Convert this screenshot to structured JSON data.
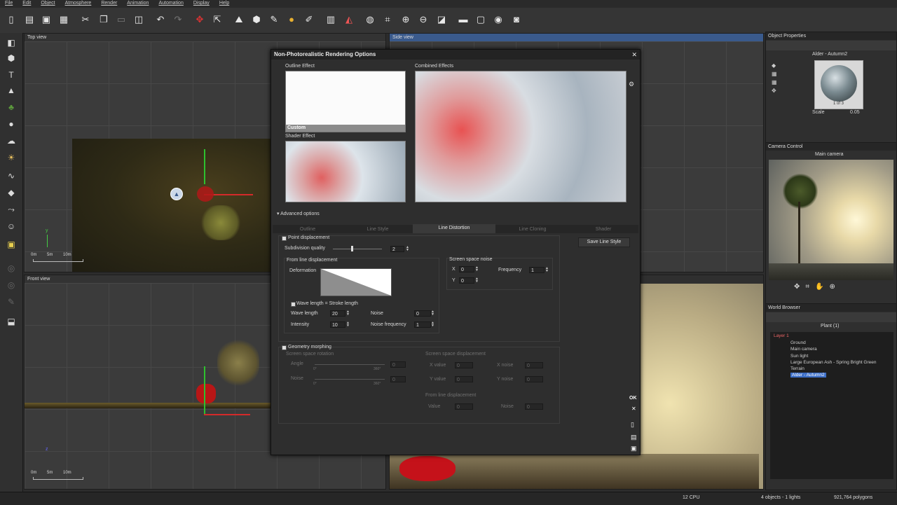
{
  "menu": [
    "File",
    "Edit",
    "Object",
    "Atmosphere",
    "Render",
    "Animation",
    "Automation",
    "Display",
    "Help"
  ],
  "viewports": {
    "top": {
      "title": "Top view",
      "scale_labels": [
        "0m",
        "5m",
        "10m"
      ],
      "axis_y": "y"
    },
    "side": {
      "title": "Side view"
    },
    "front": {
      "title": "Front view",
      "scale_labels": [
        "0m",
        "5m",
        "10m"
      ],
      "axis_z": "z"
    }
  },
  "dialog": {
    "title": "Non-Photorealistic Rendering Options",
    "outline_effect": "Outline Effect",
    "outline_preset": "Custom",
    "shader_effect": "Shader Effect",
    "combined_effects": "Combined Effects",
    "advanced_options": "Advanced options",
    "tabs": [
      "Outline",
      "Line Style",
      "Line Distortion",
      "Line Cloning",
      "Shader"
    ],
    "point_displacement": "Point displacement",
    "subdivision_quality": "Subdivision quality",
    "subdivision_value": "2",
    "from_line_displacement": "From line displacement",
    "deformation": "Deformation",
    "wave_length_eq": "Wave length = Stroke length",
    "wave_length": "Wave length",
    "wave_length_value": "20",
    "intensity": "Intensity",
    "intensity_value": "10",
    "noise": "Noise",
    "noise_value": "0",
    "noise_frequency": "Noise frequency",
    "noise_frequency_value": "1",
    "screen_space_noise": "Screen space noise",
    "x": "X",
    "x_value": "0",
    "y": "Y",
    "y_value": "0",
    "frequency": "Frequency",
    "frequency_value": "1",
    "save_line_style": "Save Line Style",
    "geometry_morphing": "Geometry morphing",
    "screen_space_rotation": "Screen space rotation",
    "angle": "Angle",
    "angle_value": "0",
    "rot_noise": "Noise",
    "rot_noise_value": "0",
    "slider_min": "0°",
    "slider_max": "360°",
    "screen_space_displacement": "Screen space displacement",
    "x_value_lbl": "X value",
    "x_value_val": "0",
    "y_value_lbl": "Y value",
    "y_value_val": "0",
    "x_noise_lbl": "X noise",
    "x_noise_val": "0",
    "y_noise_lbl": "Y noise",
    "y_noise_val": "0",
    "from_line_displacement2": "From line displacement",
    "value_lbl": "Value",
    "value_val": "0",
    "noise2_lbl": "Noise",
    "noise2_val": "0",
    "ok": "OK"
  },
  "object_properties": {
    "title": "Object Properties",
    "material_name": "Alder - Autumn2",
    "material_counter": "1 of 3",
    "scale_label": "Scale",
    "scale_value": "0.05"
  },
  "camera_control": {
    "title": "Camera Control",
    "camera_name": "Main camera"
  },
  "world_browser": {
    "title": "World Browser",
    "subtitle": "Plant (1)",
    "items": [
      "Layer 1",
      "Ground",
      "Main camera",
      "Sun light",
      "Large European Ash - Spring Bright Green",
      "Terrain",
      "Alder - Autumn2"
    ]
  },
  "status": {
    "cpu": "12 CPU",
    "objects": "4 objects - 1 lights",
    "polygons": "921,764 polygons"
  },
  "colors": {
    "accent": "#3a5a8c",
    "selection": "#3d6fc7",
    "red_highlight": "#cc2a2a"
  }
}
